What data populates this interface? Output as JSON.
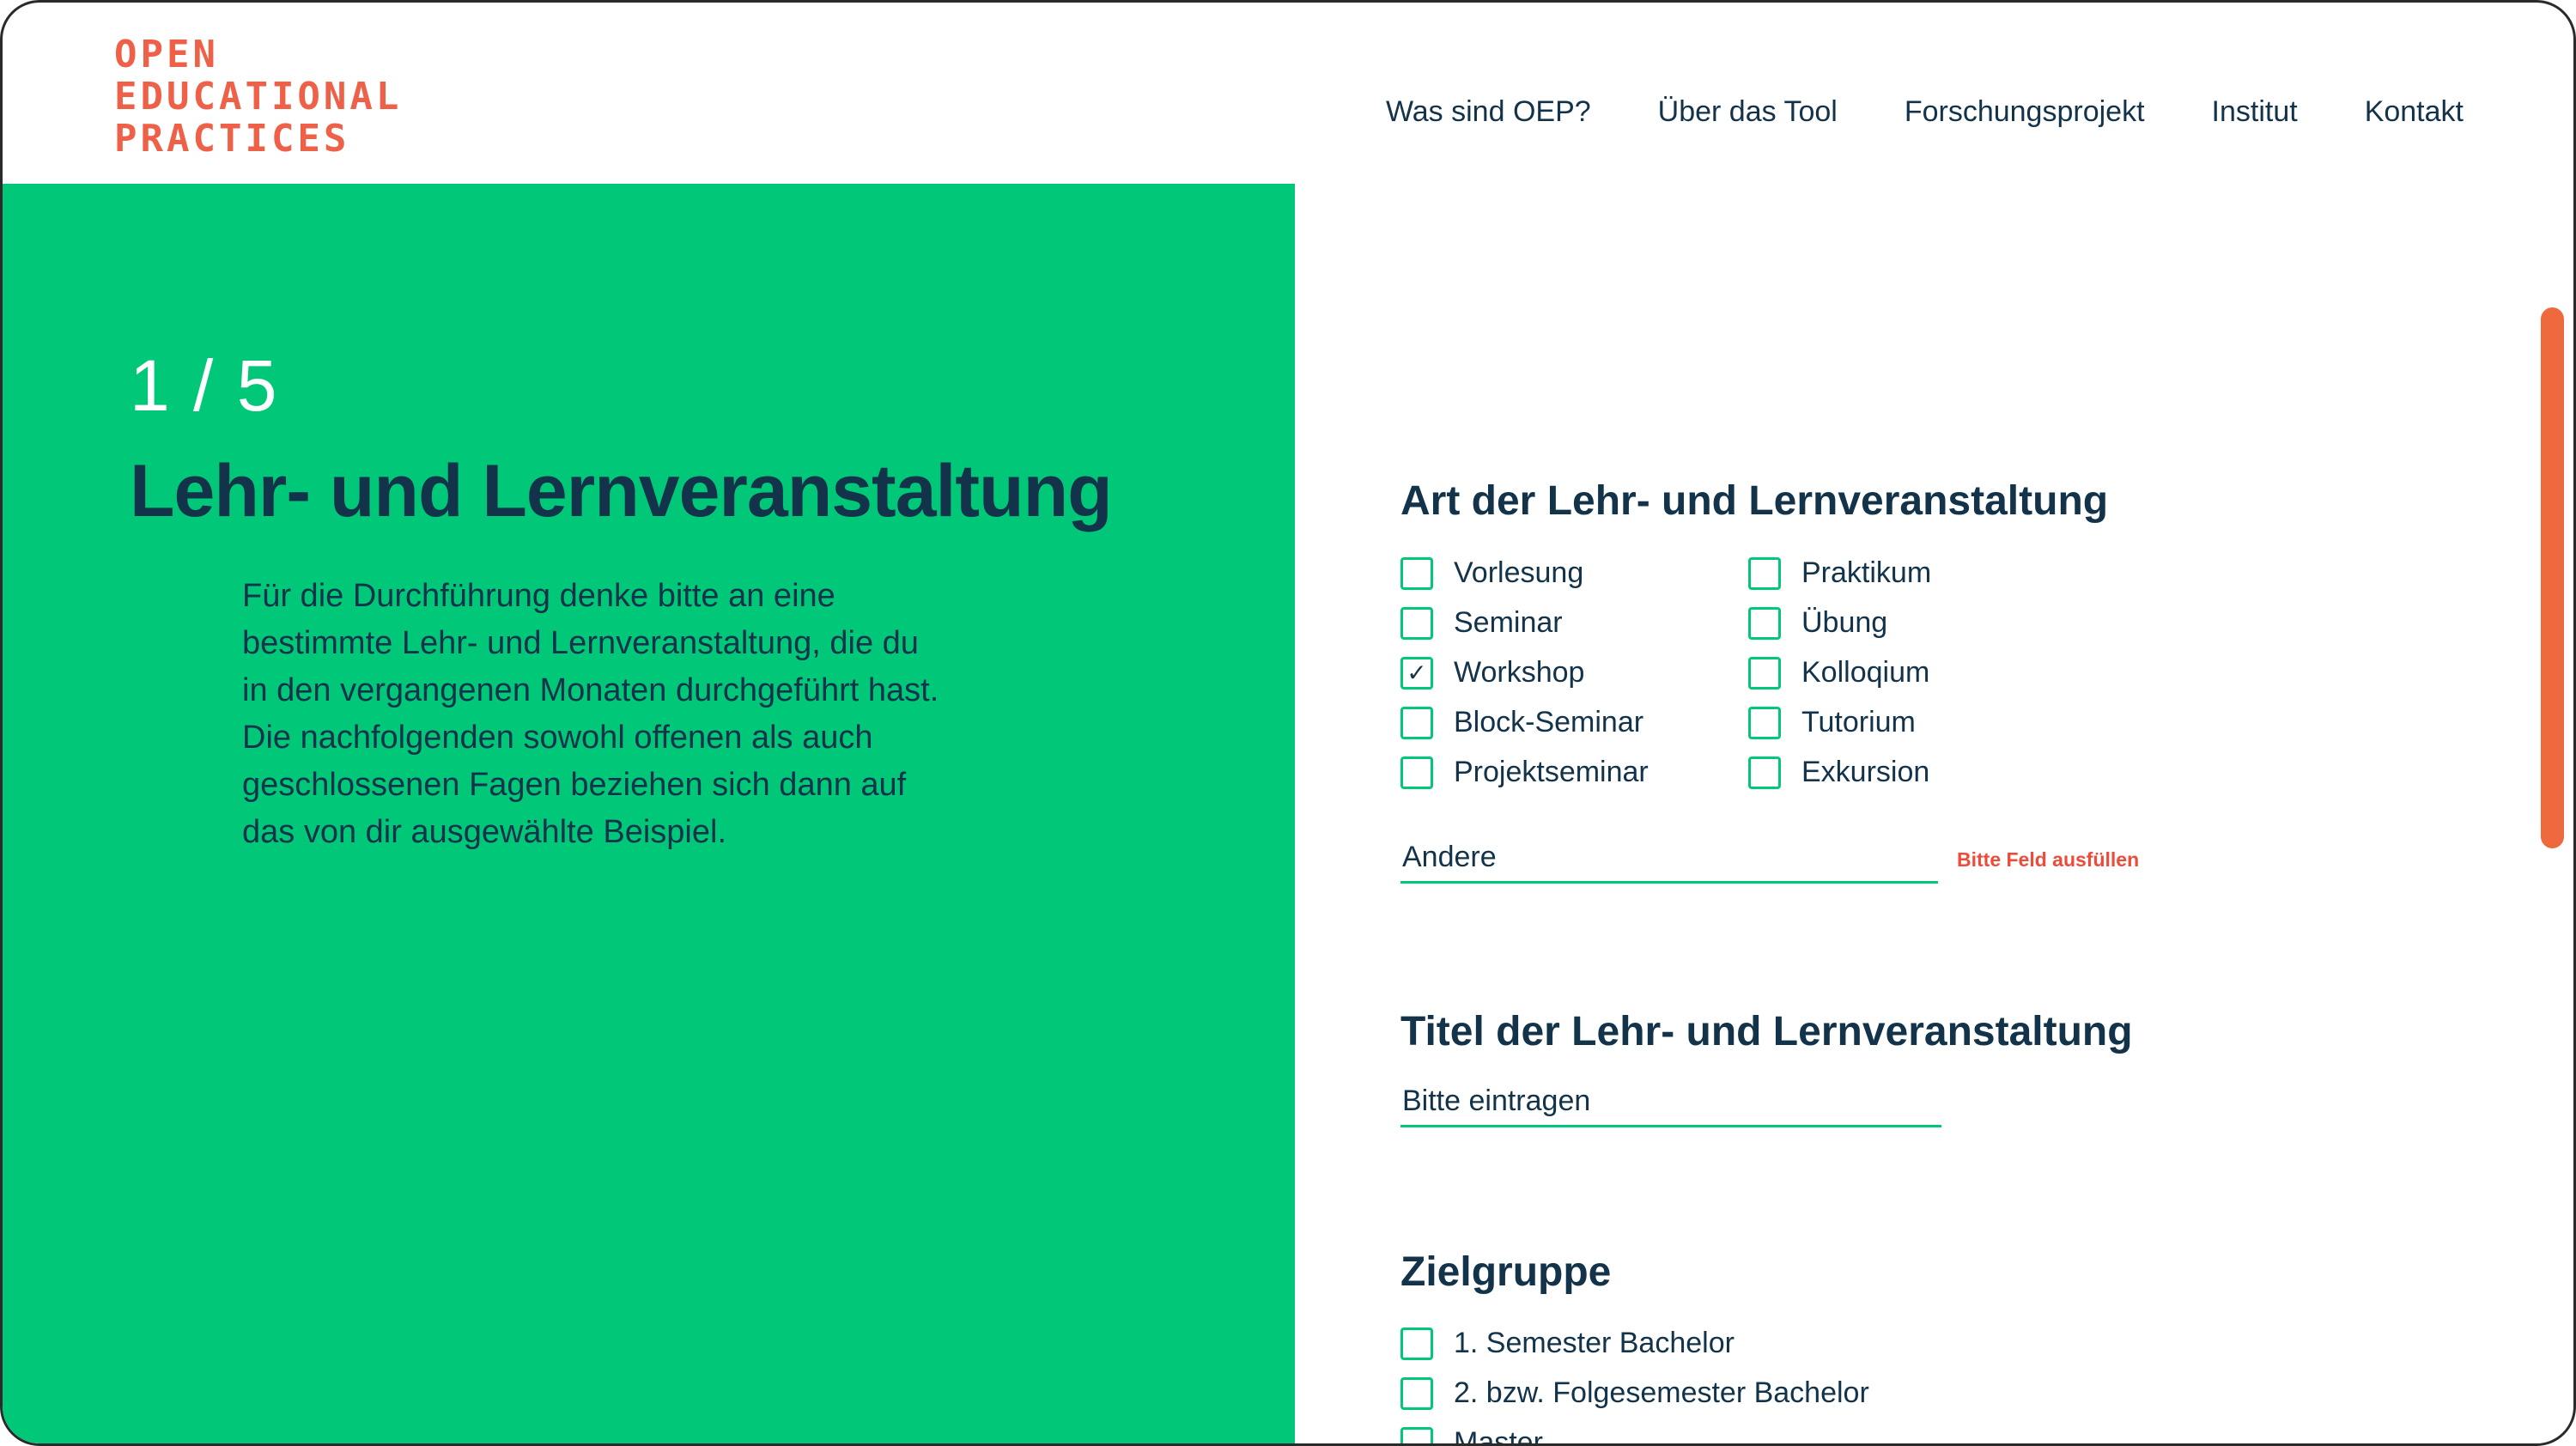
{
  "logo": {
    "line1": "OPEN",
    "line2": "EDUCATIONAL",
    "line3": "PRACTICES"
  },
  "nav": [
    "Was sind OEP?",
    "Über das Tool",
    "Forschungsprojekt",
    "Institut",
    "Kontakt"
  ],
  "hero": {
    "step": "1 / 5",
    "title": "Lehr- und Lernveranstaltung",
    "intro_lines": [
      "Für die Durchführung denke bitte an eine",
      "bestimmte Lehr- und Lernveranstaltung, die du",
      "in den vergangenen Monaten durchgeführt hast.",
      "Die nachfolgenden sowohl offenen als auch",
      "geschlossenen Fagen beziehen sich dann auf",
      "das von dir ausgewählte Beispiel."
    ]
  },
  "art": {
    "title": "Art der Lehr- und Lernveranstaltung",
    "options_left": [
      {
        "label": "Vorlesung",
        "checked": false
      },
      {
        "label": "Seminar",
        "checked": false
      },
      {
        "label": "Workshop",
        "checked": true
      },
      {
        "label": "Block-Seminar",
        "checked": false
      },
      {
        "label": "Projektseminar",
        "checked": false
      }
    ],
    "options_right": [
      {
        "label": "Praktikum",
        "checked": false
      },
      {
        "label": "Übung",
        "checked": false
      },
      {
        "label": "Kolloqium",
        "checked": false
      },
      {
        "label": "Tutorium",
        "checked": false
      },
      {
        "label": "Exkursion",
        "checked": false
      }
    ],
    "other_placeholder": "Andere",
    "other_value": "",
    "error": "Bitte Feld ausfüllen"
  },
  "titel": {
    "title": "Titel der Lehr- und Lernveranstaltung",
    "placeholder": "Bitte eintragen",
    "value": ""
  },
  "zielgruppe": {
    "title": "Zielgruppe",
    "options": [
      {
        "label": "1. Semester Bachelor",
        "checked": false
      },
      {
        "label": "2. bzw. Folgesemester Bachelor",
        "checked": false
      },
      {
        "label": "Master",
        "checked": false
      }
    ]
  },
  "colors": {
    "green": "#00c878",
    "navy": "#12334a",
    "accent": "#ee6148",
    "error": "#ee4b3a"
  },
  "icons": {
    "check": "check-icon"
  }
}
